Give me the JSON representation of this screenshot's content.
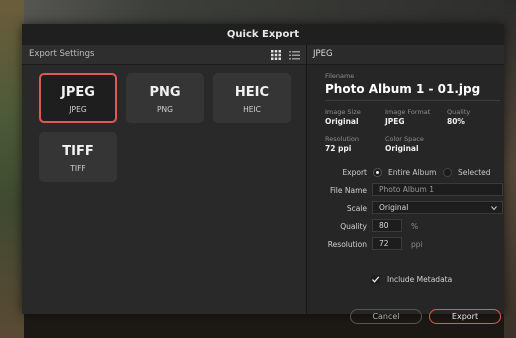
{
  "dialog": {
    "title": "Quick Export"
  },
  "left_panel": {
    "header_label": "Export Settings",
    "view_icons": [
      "grid-view-icon",
      "list-view-icon"
    ],
    "formats": [
      {
        "title": "JPEG",
        "subtitle": "JPEG",
        "selected": true
      },
      {
        "title": "PNG",
        "subtitle": "PNG",
        "selected": false
      },
      {
        "title": "HEIC",
        "subtitle": "HEIC",
        "selected": false
      },
      {
        "title": "TIFF",
        "subtitle": "TIFF",
        "selected": false
      }
    ]
  },
  "right_panel": {
    "header_label": "JPEG",
    "filename_label": "Filename",
    "filename_value": "Photo Album 1 - 01.jpg",
    "image_size_label": "Image Size",
    "image_size_value": "Original",
    "image_format_label": "Image Format",
    "image_format_value": "JPEG",
    "quality_info_label": "Quality",
    "quality_info_value": "80%",
    "resolution_info_label": "Resolution",
    "resolution_info_value": "72 ppi",
    "color_space_label": "Color Space",
    "color_space_value": "Original",
    "form": {
      "export_label": "Export",
      "export_options": [
        "Entire Album",
        "Selected"
      ],
      "export_selected": "Entire Album",
      "file_name_label": "File Name",
      "file_name_value": "Photo Album 1",
      "scale_label": "Scale",
      "scale_value": "Original",
      "quality_label": "Quality",
      "quality_value": "80",
      "quality_unit": "%",
      "resolution_label": "Resolution",
      "resolution_value": "72",
      "resolution_unit": "ppi",
      "metadata_label": "Include Metadata",
      "metadata_checked": true
    },
    "buttons": {
      "cancel": "Cancel",
      "export": "Export"
    }
  },
  "colors": {
    "accent": "#e05a55",
    "dialog_bg": "#262626",
    "title_bg": "#1f1f1f"
  }
}
